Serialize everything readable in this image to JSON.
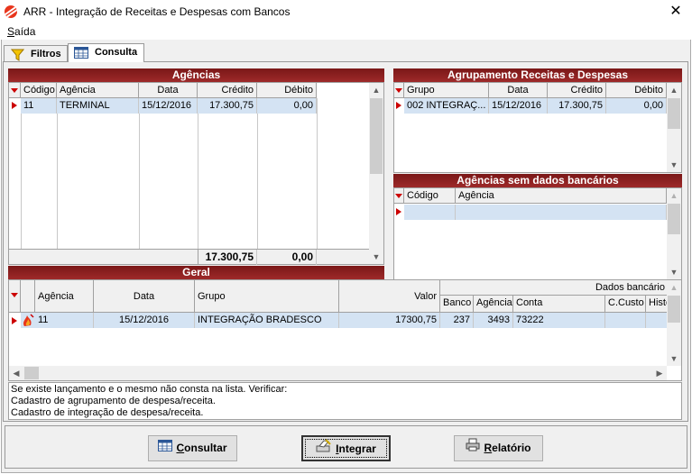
{
  "window": {
    "title": "ARR -  Integração de Receitas e Despesas com Bancos"
  },
  "menu": {
    "items": [
      {
        "label": "Saída"
      }
    ]
  },
  "tabs": [
    {
      "label": "Filtros",
      "icon": "filter-icon"
    },
    {
      "label": "Consulta",
      "icon": "table-icon",
      "active": true
    }
  ],
  "agencias": {
    "title": "Agências",
    "columns": [
      "Código",
      "Agência",
      "Data",
      "Crédito",
      "Débito"
    ],
    "rows": [
      {
        "codigo": "11",
        "agencia": "TERMINAL",
        "data": "15/12/2016",
        "credito": "17.300,75",
        "debito": "0,00"
      }
    ],
    "total_credito": "17.300,75",
    "total_debito": "0,00"
  },
  "agrupamento": {
    "title": "Agrupamento Receitas e Despesas",
    "columns": [
      "Grupo",
      "Data",
      "Crédito",
      "Débito"
    ],
    "rows": [
      {
        "grupo": "002 INTEGRAÇ...",
        "data": "15/12/2016",
        "credito": "17.300,75",
        "debito": "0,00"
      }
    ]
  },
  "sem_dados": {
    "title": "Agências sem dados bancários",
    "columns": [
      "Código",
      "Agência"
    ]
  },
  "geral": {
    "title": "Geral",
    "columns": [
      "Agência",
      "Data",
      "Grupo",
      "Valor"
    ],
    "group_header": "Dados bancário",
    "sub_columns": [
      "Banco",
      "Agência",
      "Conta",
      "C.Custo",
      "Históri"
    ],
    "rows": [
      {
        "agencia": "11",
        "data": "15/12/2016",
        "grupo": "INTEGRAÇÃO BRADESCO",
        "valor": "17300,75",
        "banco": "237",
        "ag_bancaria": "3493",
        "conta": "73222",
        "ccusto": "",
        "historico": ""
      }
    ]
  },
  "message": {
    "lines": [
      "Se existe lançamento e o mesmo não consta na lista. Verificar:",
      "Cadastro de agrupamento de despesa/receita.",
      "Cadastro de integração de despesa/receita."
    ]
  },
  "buttons": {
    "consultar": {
      "mnemonic": "C",
      "rest": "onsultar"
    },
    "integrar": {
      "mnemonic": "I",
      "rest": "ntegrar"
    },
    "relatorio": {
      "mnemonic": "R",
      "rest": "elatório"
    }
  },
  "colors": {
    "header_red": "#8b1f1f",
    "selection": "#d4e3f3",
    "indicator": "#cc0000"
  }
}
